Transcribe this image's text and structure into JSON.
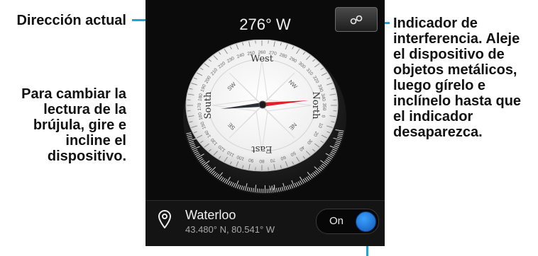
{
  "annotations": {
    "current_direction": "Dirección actual",
    "instructions": "Para cambiar la lectura de la brújula, gire e incline el dispositivo.",
    "interference": "Indicador de interferencia. Aleje el dispositivo de objetos metálicos, luego gírelo e inclínelo hasta que el indicador desaparezca."
  },
  "compass": {
    "heading": "276° W",
    "interference_icon": "link-icon",
    "cardinals": {
      "north": "North",
      "south": "South",
      "east": "East",
      "west": "West"
    },
    "intercardinals": {
      "ne": "NE",
      "nw": "NW",
      "se": "SE",
      "sw": "SW"
    },
    "degree_labels": [
      "260",
      "270",
      "280",
      "290",
      "300",
      "250",
      "240",
      "230",
      "220",
      "210",
      "200",
      "190",
      "180",
      "170",
      "160",
      "150",
      "140",
      "130",
      "120",
      "110",
      "100",
      "90",
      "80",
      "70",
      "60",
      "50",
      "40",
      "30",
      "20",
      "10",
      "0",
      "350",
      "340",
      "330",
      "320",
      "310"
    ],
    "bezel_label": "W",
    "needle_colors": {
      "north": "#e0202a",
      "south": "#2a2e35"
    }
  },
  "location": {
    "pin_icon": "location-pin-icon",
    "city": "Waterloo",
    "coords": "43.480° N, 80.541° W"
  },
  "toggle": {
    "label": "On",
    "state": "on",
    "color": "#1e6fd0"
  }
}
